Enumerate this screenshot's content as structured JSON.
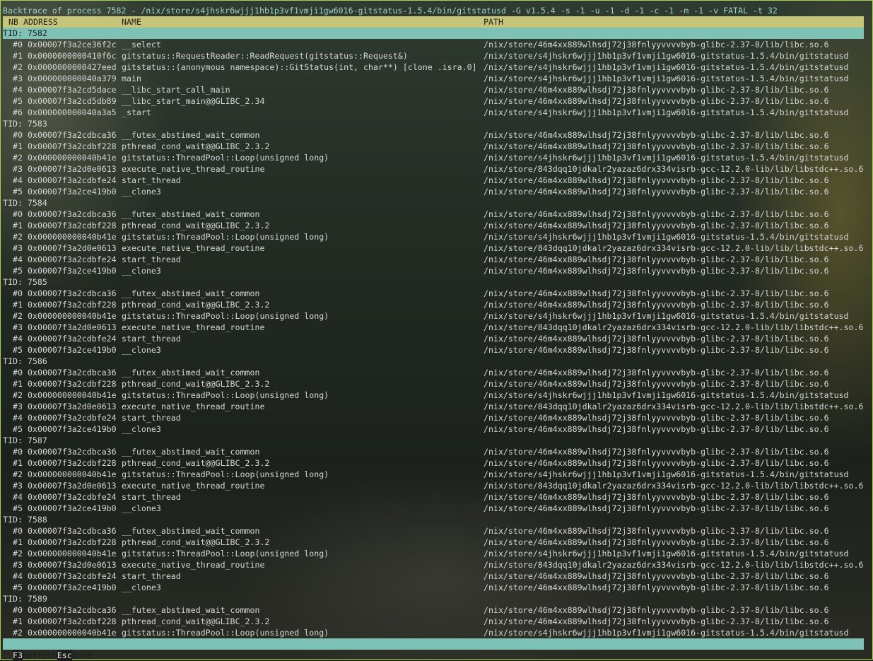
{
  "title": "Backtrace of process 7582 - /nix/store/s4jhskr6wjjj1hb1p3vf1vmji1gw6016-gitstatus-1.5.4/bin/gitstatusd -G v1.5.4 -s -1 -u -1 -d -1 -c -1 -m -1 -v FATAL -t 32",
  "columns": {
    "nb": "NB",
    "address": "ADDRESS",
    "name": "NAME",
    "path": "PATH"
  },
  "threads": [
    {
      "label": "TID: 7582",
      "frames": [
        [
          "#0",
          "0x00007f3a2ce36f2c",
          "__select",
          "/nix/store/46m4xx889wlhsdj72j38fnlyyvvvvbyb-glibc-2.37-8/lib/libc.so.6"
        ],
        [
          "#1",
          "0x0000000000410f6c",
          "gitstatus::RequestReader::ReadRequest(gitstatus::Request&)",
          "/nix/store/s4jhskr6wjjj1hb1p3vf1vmji1gw6016-gitstatus-1.5.4/bin/gitstatusd"
        ],
        [
          "#2",
          "0x0000000000427eed",
          "gitstatus::(anonymous namespace)::GitStatus(int, char**) [clone .isra.0]",
          "/nix/store/s4jhskr6wjjj1hb1p3vf1vmji1gw6016-gitstatus-1.5.4/bin/gitstatusd"
        ],
        [
          "#3",
          "0x000000000040a379",
          "main",
          "/nix/store/s4jhskr6wjjj1hb1p3vf1vmji1gw6016-gitstatus-1.5.4/bin/gitstatusd"
        ],
        [
          "#4",
          "0x00007f3a2cd5dace",
          "__libc_start_call_main",
          "/nix/store/46m4xx889wlhsdj72j38fnlyyvvvvbyb-glibc-2.37-8/lib/libc.so.6"
        ],
        [
          "#5",
          "0x00007f3a2cd5db89",
          "__libc_start_main@@GLIBC_2.34",
          "/nix/store/46m4xx889wlhsdj72j38fnlyyvvvvbyb-glibc-2.37-8/lib/libc.so.6"
        ],
        [
          "#6",
          "0x000000000040a3a5",
          "_start",
          "/nix/store/s4jhskr6wjjj1hb1p3vf1vmji1gw6016-gitstatus-1.5.4/bin/gitstatusd"
        ]
      ]
    },
    {
      "label": "TID: 7583",
      "frames": [
        [
          "#0",
          "0x00007f3a2cdbca36",
          "__futex_abstimed_wait_common",
          "/nix/store/46m4xx889wlhsdj72j38fnlyyvvvvbyb-glibc-2.37-8/lib/libc.so.6"
        ],
        [
          "#1",
          "0x00007f3a2cdbf228",
          "pthread_cond_wait@@GLIBC_2.3.2",
          "/nix/store/46m4xx889wlhsdj72j38fnlyyvvvvbyb-glibc-2.37-8/lib/libc.so.6"
        ],
        [
          "#2",
          "0x000000000040b41e",
          "gitstatus::ThreadPool::Loop(unsigned long)",
          "/nix/store/s4jhskr6wjjj1hb1p3vf1vmji1gw6016-gitstatus-1.5.4/bin/gitstatusd"
        ],
        [
          "#3",
          "0x00007f3a2d0e0613",
          "execute_native_thread_routine",
          "/nix/store/843dqq10jdkalr2yazaz6drx334visrb-gcc-12.2.0-lib/lib/libstdc++.so.6"
        ],
        [
          "#4",
          "0x00007f3a2cdbfe24",
          "start_thread",
          "/nix/store/46m4xx889wlhsdj72j38fnlyyvvvvbyb-glibc-2.37-8/lib/libc.so.6"
        ],
        [
          "#5",
          "0x00007f3a2ce419b0",
          "__clone3",
          "/nix/store/46m4xx889wlhsdj72j38fnlyyvvvvbyb-glibc-2.37-8/lib/libc.so.6"
        ]
      ]
    },
    {
      "label": "TID: 7584",
      "frames": [
        [
          "#0",
          "0x00007f3a2cdbca36",
          "__futex_abstimed_wait_common",
          "/nix/store/46m4xx889wlhsdj72j38fnlyyvvvvbyb-glibc-2.37-8/lib/libc.so.6"
        ],
        [
          "#1",
          "0x00007f3a2cdbf228",
          "pthread_cond_wait@@GLIBC_2.3.2",
          "/nix/store/46m4xx889wlhsdj72j38fnlyyvvvvbyb-glibc-2.37-8/lib/libc.so.6"
        ],
        [
          "#2",
          "0x000000000040b41e",
          "gitstatus::ThreadPool::Loop(unsigned long)",
          "/nix/store/s4jhskr6wjjj1hb1p3vf1vmji1gw6016-gitstatus-1.5.4/bin/gitstatusd"
        ],
        [
          "#3",
          "0x00007f3a2d0e0613",
          "execute_native_thread_routine",
          "/nix/store/843dqq10jdkalr2yazaz6drx334visrb-gcc-12.2.0-lib/lib/libstdc++.so.6"
        ],
        [
          "#4",
          "0x00007f3a2cdbfe24",
          "start_thread",
          "/nix/store/46m4xx889wlhsdj72j38fnlyyvvvvbyb-glibc-2.37-8/lib/libc.so.6"
        ],
        [
          "#5",
          "0x00007f3a2ce419b0",
          "__clone3",
          "/nix/store/46m4xx889wlhsdj72j38fnlyyvvvvbyb-glibc-2.37-8/lib/libc.so.6"
        ]
      ]
    },
    {
      "label": "TID: 7585",
      "frames": [
        [
          "#0",
          "0x00007f3a2cdbca36",
          "__futex_abstimed_wait_common",
          "/nix/store/46m4xx889wlhsdj72j38fnlyyvvvvbyb-glibc-2.37-8/lib/libc.so.6"
        ],
        [
          "#1",
          "0x00007f3a2cdbf228",
          "pthread_cond_wait@@GLIBC_2.3.2",
          "/nix/store/46m4xx889wlhsdj72j38fnlyyvvvvbyb-glibc-2.37-8/lib/libc.so.6"
        ],
        [
          "#2",
          "0x000000000040b41e",
          "gitstatus::ThreadPool::Loop(unsigned long)",
          "/nix/store/s4jhskr6wjjj1hb1p3vf1vmji1gw6016-gitstatus-1.5.4/bin/gitstatusd"
        ],
        [
          "#3",
          "0x00007f3a2d0e0613",
          "execute_native_thread_routine",
          "/nix/store/843dqq10jdkalr2yazaz6drx334visrb-gcc-12.2.0-lib/lib/libstdc++.so.6"
        ],
        [
          "#4",
          "0x00007f3a2cdbfe24",
          "start_thread",
          "/nix/store/46m4xx889wlhsdj72j38fnlyyvvvvbyb-glibc-2.37-8/lib/libc.so.6"
        ],
        [
          "#5",
          "0x00007f3a2ce419b0",
          "__clone3",
          "/nix/store/46m4xx889wlhsdj72j38fnlyyvvvvbyb-glibc-2.37-8/lib/libc.so.6"
        ]
      ]
    },
    {
      "label": "TID: 7586",
      "frames": [
        [
          "#0",
          "0x00007f3a2cdbca36",
          "__futex_abstimed_wait_common",
          "/nix/store/46m4xx889wlhsdj72j38fnlyyvvvvbyb-glibc-2.37-8/lib/libc.so.6"
        ],
        [
          "#1",
          "0x00007f3a2cdbf228",
          "pthread_cond_wait@@GLIBC_2.3.2",
          "/nix/store/46m4xx889wlhsdj72j38fnlyyvvvvbyb-glibc-2.37-8/lib/libc.so.6"
        ],
        [
          "#2",
          "0x000000000040b41e",
          "gitstatus::ThreadPool::Loop(unsigned long)",
          "/nix/store/s4jhskr6wjjj1hb1p3vf1vmji1gw6016-gitstatus-1.5.4/bin/gitstatusd"
        ],
        [
          "#3",
          "0x00007f3a2d0e0613",
          "execute_native_thread_routine",
          "/nix/store/843dqq10jdkalr2yazaz6drx334visrb-gcc-12.2.0-lib/lib/libstdc++.so.6"
        ],
        [
          "#4",
          "0x00007f3a2cdbfe24",
          "start_thread",
          "/nix/store/46m4xx889wlhsdj72j38fnlyyvvvvbyb-glibc-2.37-8/lib/libc.so.6"
        ],
        [
          "#5",
          "0x00007f3a2ce419b0",
          "__clone3",
          "/nix/store/46m4xx889wlhsdj72j38fnlyyvvvvbyb-glibc-2.37-8/lib/libc.so.6"
        ]
      ]
    },
    {
      "label": "TID: 7587",
      "frames": [
        [
          "#0",
          "0x00007f3a2cdbca36",
          "__futex_abstimed_wait_common",
          "/nix/store/46m4xx889wlhsdj72j38fnlyyvvvvbyb-glibc-2.37-8/lib/libc.so.6"
        ],
        [
          "#1",
          "0x00007f3a2cdbf228",
          "pthread_cond_wait@@GLIBC_2.3.2",
          "/nix/store/46m4xx889wlhsdj72j38fnlyyvvvvbyb-glibc-2.37-8/lib/libc.so.6"
        ],
        [
          "#2",
          "0x000000000040b41e",
          "gitstatus::ThreadPool::Loop(unsigned long)",
          "/nix/store/s4jhskr6wjjj1hb1p3vf1vmji1gw6016-gitstatus-1.5.4/bin/gitstatusd"
        ],
        [
          "#3",
          "0x00007f3a2d0e0613",
          "execute_native_thread_routine",
          "/nix/store/843dqq10jdkalr2yazaz6drx334visrb-gcc-12.2.0-lib/lib/libstdc++.so.6"
        ],
        [
          "#4",
          "0x00007f3a2cdbfe24",
          "start_thread",
          "/nix/store/46m4xx889wlhsdj72j38fnlyyvvvvbyb-glibc-2.37-8/lib/libc.so.6"
        ],
        [
          "#5",
          "0x00007f3a2ce419b0",
          "__clone3",
          "/nix/store/46m4xx889wlhsdj72j38fnlyyvvvvbyb-glibc-2.37-8/lib/libc.so.6"
        ]
      ]
    },
    {
      "label": "TID: 7588",
      "frames": [
        [
          "#0",
          "0x00007f3a2cdbca36",
          "__futex_abstimed_wait_common",
          "/nix/store/46m4xx889wlhsdj72j38fnlyyvvvvbyb-glibc-2.37-8/lib/libc.so.6"
        ],
        [
          "#1",
          "0x00007f3a2cdbf228",
          "pthread_cond_wait@@GLIBC_2.3.2",
          "/nix/store/46m4xx889wlhsdj72j38fnlyyvvvvbyb-glibc-2.37-8/lib/libc.so.6"
        ],
        [
          "#2",
          "0x000000000040b41e",
          "gitstatus::ThreadPool::Loop(unsigned long)",
          "/nix/store/s4jhskr6wjjj1hb1p3vf1vmji1gw6016-gitstatus-1.5.4/bin/gitstatusd"
        ],
        [
          "#3",
          "0x00007f3a2d0e0613",
          "execute_native_thread_routine",
          "/nix/store/843dqq10jdkalr2yazaz6drx334visrb-gcc-12.2.0-lib/lib/libstdc++.so.6"
        ],
        [
          "#4",
          "0x00007f3a2cdbfe24",
          "start_thread",
          "/nix/store/46m4xx889wlhsdj72j38fnlyyvvvvbyb-glibc-2.37-8/lib/libc.so.6"
        ],
        [
          "#5",
          "0x00007f3a2ce419b0",
          "__clone3",
          "/nix/store/46m4xx889wlhsdj72j38fnlyyvvvvbyb-glibc-2.37-8/lib/libc.so.6"
        ]
      ]
    },
    {
      "label": "TID: 7589",
      "frames": [
        [
          "#0",
          "0x00007f3a2cdbca36",
          "__futex_abstimed_wait_common",
          "/nix/store/46m4xx889wlhsdj72j38fnlyyvvvvbyb-glibc-2.37-8/lib/libc.so.6"
        ],
        [
          "#1",
          "0x00007f3a2cdbf228",
          "pthread_cond_wait@@GLIBC_2.3.2",
          "/nix/store/46m4xx889wlhsdj72j38fnlyyvvvvbyb-glibc-2.37-8/lib/libc.so.6"
        ],
        [
          "#2",
          "0x000000000040b41e",
          "gitstatus::ThreadPool::Loop(unsigned long)",
          "/nix/store/s4jhskr6wjjj1hb1p3vf1vmji1gw6016-gitstatus-1.5.4/bin/gitstatusd"
        ]
      ]
    }
  ],
  "selected_thread": "TID: 7582",
  "footer": [
    {
      "key": "F3",
      "label": "Refresh"
    },
    {
      "key": "Esc",
      "label": "Done"
    }
  ],
  "colors": {
    "header_bg": "#c7c57a",
    "selected_bg": "#7ec2b6",
    "border": "#a8d24a",
    "title_fg": "#9fd0c6",
    "text_fg": "#d6d6d6"
  }
}
